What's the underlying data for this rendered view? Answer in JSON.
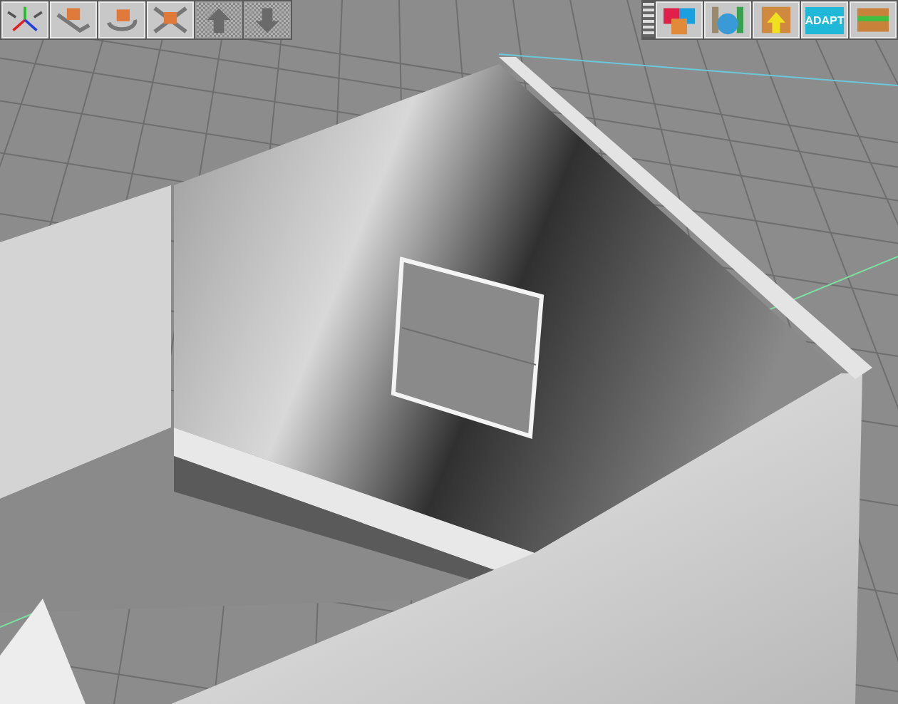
{
  "left_toolbar": {
    "tools": [
      {
        "kind": "axes",
        "disabled": false
      },
      {
        "kind": "move",
        "disabled": false
      },
      {
        "kind": "rotate",
        "disabled": false
      },
      {
        "kind": "scale",
        "disabled": false
      },
      {
        "kind": "up",
        "disabled": true
      },
      {
        "kind": "down",
        "disabled": true
      }
    ]
  },
  "right_toolbar": {
    "tools": [
      {
        "kind": "blocks"
      },
      {
        "kind": "sphere"
      },
      {
        "kind": "insert"
      },
      {
        "kind": "adapt",
        "label": "ADAPT"
      },
      {
        "kind": "layers"
      }
    ]
  }
}
